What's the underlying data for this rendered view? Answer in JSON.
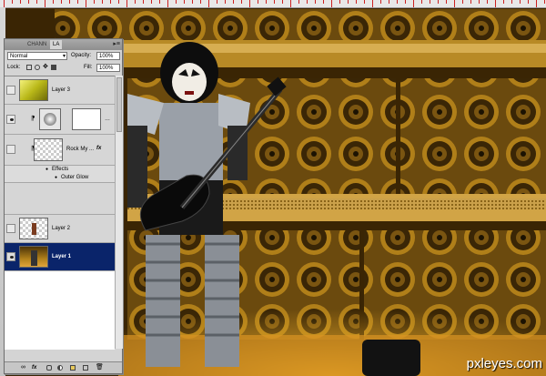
{
  "colors": {
    "panel_bg": "#d4d4d4",
    "selected_row": "#0a246a",
    "amp_gold": "#c9921f"
  },
  "panel": {
    "tabs": [
      "CHANN",
      "LA"
    ],
    "menu_icon": "panel-menu-icon",
    "blend_mode": "Normal",
    "opacity_label": "Opacity:",
    "opacity_value": "100%",
    "lock_label": "Lock:",
    "fill_label": "Fill:",
    "fill_value": "100%"
  },
  "layers": [
    {
      "name": "Layer 3",
      "type": "gradient",
      "visible": false,
      "selected": false
    },
    {
      "name": "",
      "type": "adjustment",
      "visible": true,
      "selected": false
    },
    {
      "name": "Rock My ...",
      "type": "transparent",
      "visible": false,
      "selected": false,
      "fx": "fx"
    },
    {
      "name": "Effects",
      "type": "effects",
      "visible": false,
      "selected": false
    },
    {
      "name": "Outer Glow",
      "type": "effect-item",
      "visible": false,
      "selected": false
    },
    {
      "name": "Layer 2",
      "type": "figure",
      "visible": false,
      "selected": false
    },
    {
      "name": "Layer 1",
      "type": "photo",
      "visible": true,
      "selected": true
    }
  ],
  "watermark": "pxleyes.com"
}
